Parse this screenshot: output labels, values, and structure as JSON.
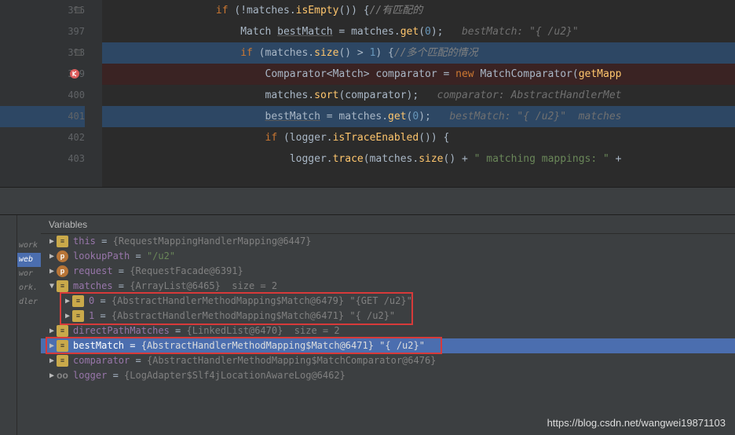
{
  "gutter": {
    "lines": [
      "396",
      "397",
      "398",
      "399",
      "400",
      "401",
      "402",
      "403",
      ""
    ]
  },
  "code": {
    "l396": {
      "kw": "if",
      "cond": "(!matches.",
      "fn": "isEmpty",
      "rest": "()) {",
      "cm": "//有匹配的"
    },
    "l397": {
      "ty": "Match ",
      "var": "bestMatch",
      "eq": " = matches.",
      "fn": "get",
      "arg": "0",
      "end": ");",
      "hint": "   bestMatch: \"{ /u2}\""
    },
    "l398": {
      "kw": "if",
      "cond": " (matches.",
      "fn": "size",
      "rest": "() > ",
      "num": "1",
      "tail": ") {",
      "cm": "//多个匹配的情况"
    },
    "l399": {
      "ty": "Comparator<Match> comparator = ",
      "kw": "new",
      "cls": " MatchComparator(",
      "fn": "getMapp"
    },
    "l400": {
      "a": "matches.",
      "fn": "sort",
      "b": "(comparator);",
      "hint": "   comparator: AbstractHandlerMet"
    },
    "l401": {
      "var": "bestMatch",
      "eq": " = matches.",
      "fn": "get",
      "arg": "0",
      "end": ");",
      "hint": "   bestMatch: \"{ /u2}\"  matches "
    },
    "l402": {
      "kw": "if",
      "a": " (logger.",
      "fn": "isTraceEnabled",
      "b": "()) {"
    },
    "l403": {
      "a": "logger.",
      "fn": "trace",
      "b": "(matches.",
      "fn2": "size",
      "c": "() + ",
      "str": "\" matching mappings: \"",
      "d": " +"
    }
  },
  "debug": {
    "header": "Variables",
    "frames": [
      "work",
      "web",
      "wor",
      "ork.",
      "dler"
    ],
    "vars": {
      "this_name": "this",
      "this_val": "{RequestMappingHandlerMapping@6447}",
      "lookup_name": "lookupPath",
      "lookup_val": "\"/u2\"",
      "request_name": "request",
      "request_val": "{RequestFacade@6391}",
      "matches_name": "matches",
      "matches_val": "{ArrayList@6465}  size = 2",
      "m0_name": "0",
      "m0_val": "{AbstractHandlerMethodMapping$Match@6479} \"{GET /u2}\"",
      "m1_name": "1",
      "m1_val": "{AbstractHandlerMethodMapping$Match@6471} \"{ /u2}\"",
      "dpm_name": "directPathMatches",
      "dpm_val": "{LinkedList@6470}  size = 2",
      "best_name": "bestMatch",
      "best_val": "{AbstractHandlerMethodMapping$Match@6471} \"{ /u2}\"",
      "comp_name": "comparator",
      "comp_val": "{AbstractHandlerMethodMapping$MatchComparator@6476}",
      "logger_name": "logger",
      "logger_val": "{LogAdapter$Slf4jLocationAwareLog@6462}"
    }
  },
  "watermark": "https://blog.csdn.net/wangwei19871103"
}
